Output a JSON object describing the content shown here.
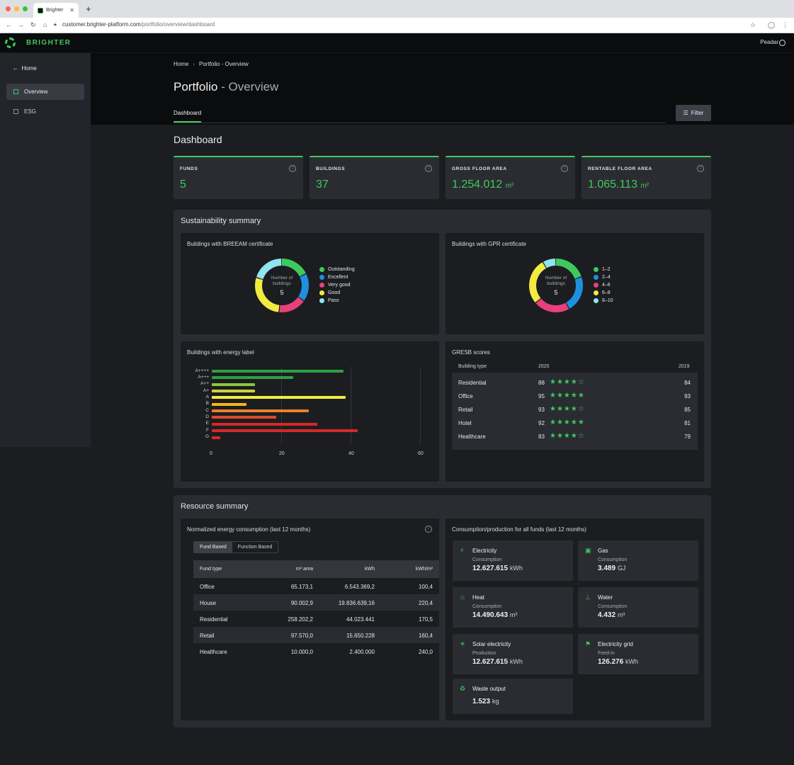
{
  "browser": {
    "tab_title": "Brighter",
    "url_host": "customer.brighter-platform.com",
    "url_path": "/portfolio/overview/dashboard"
  },
  "header": {
    "brand": "BRIGHTER",
    "user": "Peadar"
  },
  "sidebar": {
    "back_label": "Home",
    "items": [
      {
        "label": "Overview",
        "icon": "grid-icon",
        "active": true
      },
      {
        "label": "ESG",
        "icon": "building-icon",
        "active": false
      }
    ]
  },
  "page": {
    "breadcrumb": [
      "Home",
      "Portfolio - Overview"
    ],
    "title_main": "Portfolio",
    "title_sub": " - Overview",
    "tab": "Dashboard",
    "filter_label": "Filter",
    "section_heading": "Dashboard"
  },
  "kpis": [
    {
      "label": "FUNDS",
      "value": "5",
      "unit": ""
    },
    {
      "label": "BUILDINGS",
      "value": "37",
      "unit": ""
    },
    {
      "label": "GROSS FLOOR AREA",
      "value": "1.254.012",
      "unit": "m²"
    },
    {
      "label": "RENTABLE FLOOR AREA",
      "value": "1.065.113",
      "unit": "m²"
    }
  ],
  "sustainability": {
    "title": "Sustainability summary",
    "breeam": {
      "title": "Buildings with BREEAM certificate",
      "center_label": "Number of buildings",
      "center_value": "5",
      "legend": [
        {
          "label": "Outstanding",
          "color": "#3fc95d"
        },
        {
          "label": "Excellent",
          "color": "#1e90e0"
        },
        {
          "label": "Very good",
          "color": "#e8417a"
        },
        {
          "label": "Good",
          "color": "#f1ec3f"
        },
        {
          "label": "Pass",
          "color": "#8fe4f0"
        }
      ]
    },
    "gpr": {
      "title": "Buildings with GPR certificate",
      "center_label": "Number of buildings",
      "center_value": "5",
      "legend": [
        {
          "label": "1–2",
          "color": "#3fc95d"
        },
        {
          "label": "2–4",
          "color": "#1e90e0"
        },
        {
          "label": "4–6",
          "color": "#e8417a"
        },
        {
          "label": "6–8",
          "color": "#f1ec3f"
        },
        {
          "label": "8–10",
          "color": "#8fe4f0"
        }
      ]
    },
    "energy_label_title": "Buildings with energy label",
    "gresb": {
      "title": "GRESB scores",
      "headers": [
        "Building type",
        "2020",
        "2019"
      ],
      "rows": [
        {
          "type": "Residential",
          "score2020": "88",
          "stars": "★★★★☆",
          "score2019": "84"
        },
        {
          "type": "Office",
          "score2020": "95",
          "stars": "★★★★★",
          "score2019": "93"
        },
        {
          "type": "Retail",
          "score2020": "93",
          "stars": "★★★★☆",
          "score2019": "85"
        },
        {
          "type": "Hotel",
          "score2020": "92",
          "stars": "★★★★★",
          "score2019": "81"
        },
        {
          "type": "Healthcare",
          "score2020": "83",
          "stars": "★★★★☆",
          "score2019": "79"
        }
      ]
    }
  },
  "chart_data": [
    {
      "type": "pie",
      "title": "Buildings with BREEAM certificate",
      "labels": [
        "Outstanding",
        "Excellent",
        "Very good",
        "Good",
        "Pass"
      ],
      "values": [
        18,
        17,
        17,
        28,
        20
      ],
      "colors": [
        "#3fc95d",
        "#1e90e0",
        "#e8417a",
        "#f1ec3f",
        "#8fe4f0"
      ]
    },
    {
      "type": "pie",
      "title": "Buildings with GPR certificate",
      "labels": [
        "1–2",
        "2–4",
        "4–6",
        "6–8",
        "8–10"
      ],
      "values": [
        20,
        22,
        22,
        28,
        8
      ],
      "colors": [
        "#3fc95d",
        "#1e90e0",
        "#e8417a",
        "#f1ec3f",
        "#8fe4f0"
      ]
    },
    {
      "type": "bar",
      "orientation": "horizontal",
      "title": "Buildings with energy label",
      "categories": [
        "A++++",
        "A+++",
        "A++",
        "A+",
        "A",
        "B",
        "C",
        "D",
        "E",
        "F",
        "G"
      ],
      "values": [
        38,
        23.5,
        12.5,
        12.5,
        38.5,
        10,
        28,
        18.5,
        30.5,
        42,
        2.5
      ],
      "colors": [
        "#2ea043",
        "#2ea043",
        "#8cc63f",
        "#c9d63a",
        "#f1ec3f",
        "#f6b51c",
        "#e8812a",
        "#e04a2a",
        "#d62828",
        "#d62828",
        "#d62828"
      ],
      "xlim": [
        0,
        60
      ],
      "xticks": [
        "0",
        "20",
        "40",
        "60"
      ]
    }
  ],
  "resource": {
    "title": "Resource summary",
    "energy": {
      "title": "Normalized energy consumption (last 12 months)",
      "toggle": [
        "Fund Based",
        "Function Based"
      ],
      "headers": [
        "Fund type",
        "m² area",
        "kWh",
        "kWh/m²"
      ],
      "rows": [
        [
          "Office",
          "65.173,1",
          "6.543.369,2",
          "100,4"
        ],
        [
          "House",
          "90.002,9",
          "19.836.639,16",
          "220,4"
        ],
        [
          "Residential",
          "258.202,2",
          "44.023.441",
          "170,5"
        ],
        [
          "Retail",
          "97.570,0",
          "15.650.228",
          "160,4"
        ],
        [
          "Healthcare",
          "10.000,0",
          "2.400.000",
          "240,0"
        ]
      ]
    },
    "consumption": {
      "title": "Consumption/production for all funds (last 12 months)",
      "cards": [
        {
          "title": "Electricity",
          "sub": "Consumption",
          "value": "12.627.615",
          "unit": "kWh",
          "icon": "plug-icon"
        },
        {
          "title": "Gas",
          "sub": "Consumption",
          "value": "3.489",
          "unit": "GJ",
          "icon": "gas-icon"
        },
        {
          "title": "Heat",
          "sub": "Consumption",
          "value": "14.490.643",
          "unit": "m³",
          "icon": "heat-icon"
        },
        {
          "title": "Water",
          "sub": "Consumption",
          "value": "4.432",
          "unit": "m³",
          "icon": "water-icon"
        },
        {
          "title": "Solar electricity",
          "sub": "Production",
          "value": "12.627.615",
          "unit": "kWh",
          "icon": "solar-icon"
        },
        {
          "title": "Electricity grid",
          "sub": "Feed-in",
          "value": "126.276",
          "unit": "kWh",
          "icon": "grid-tower-icon"
        },
        {
          "title": "Waste output",
          "sub": "",
          "value": "1.523",
          "unit": "kg",
          "icon": "waste-icon"
        }
      ]
    }
  }
}
